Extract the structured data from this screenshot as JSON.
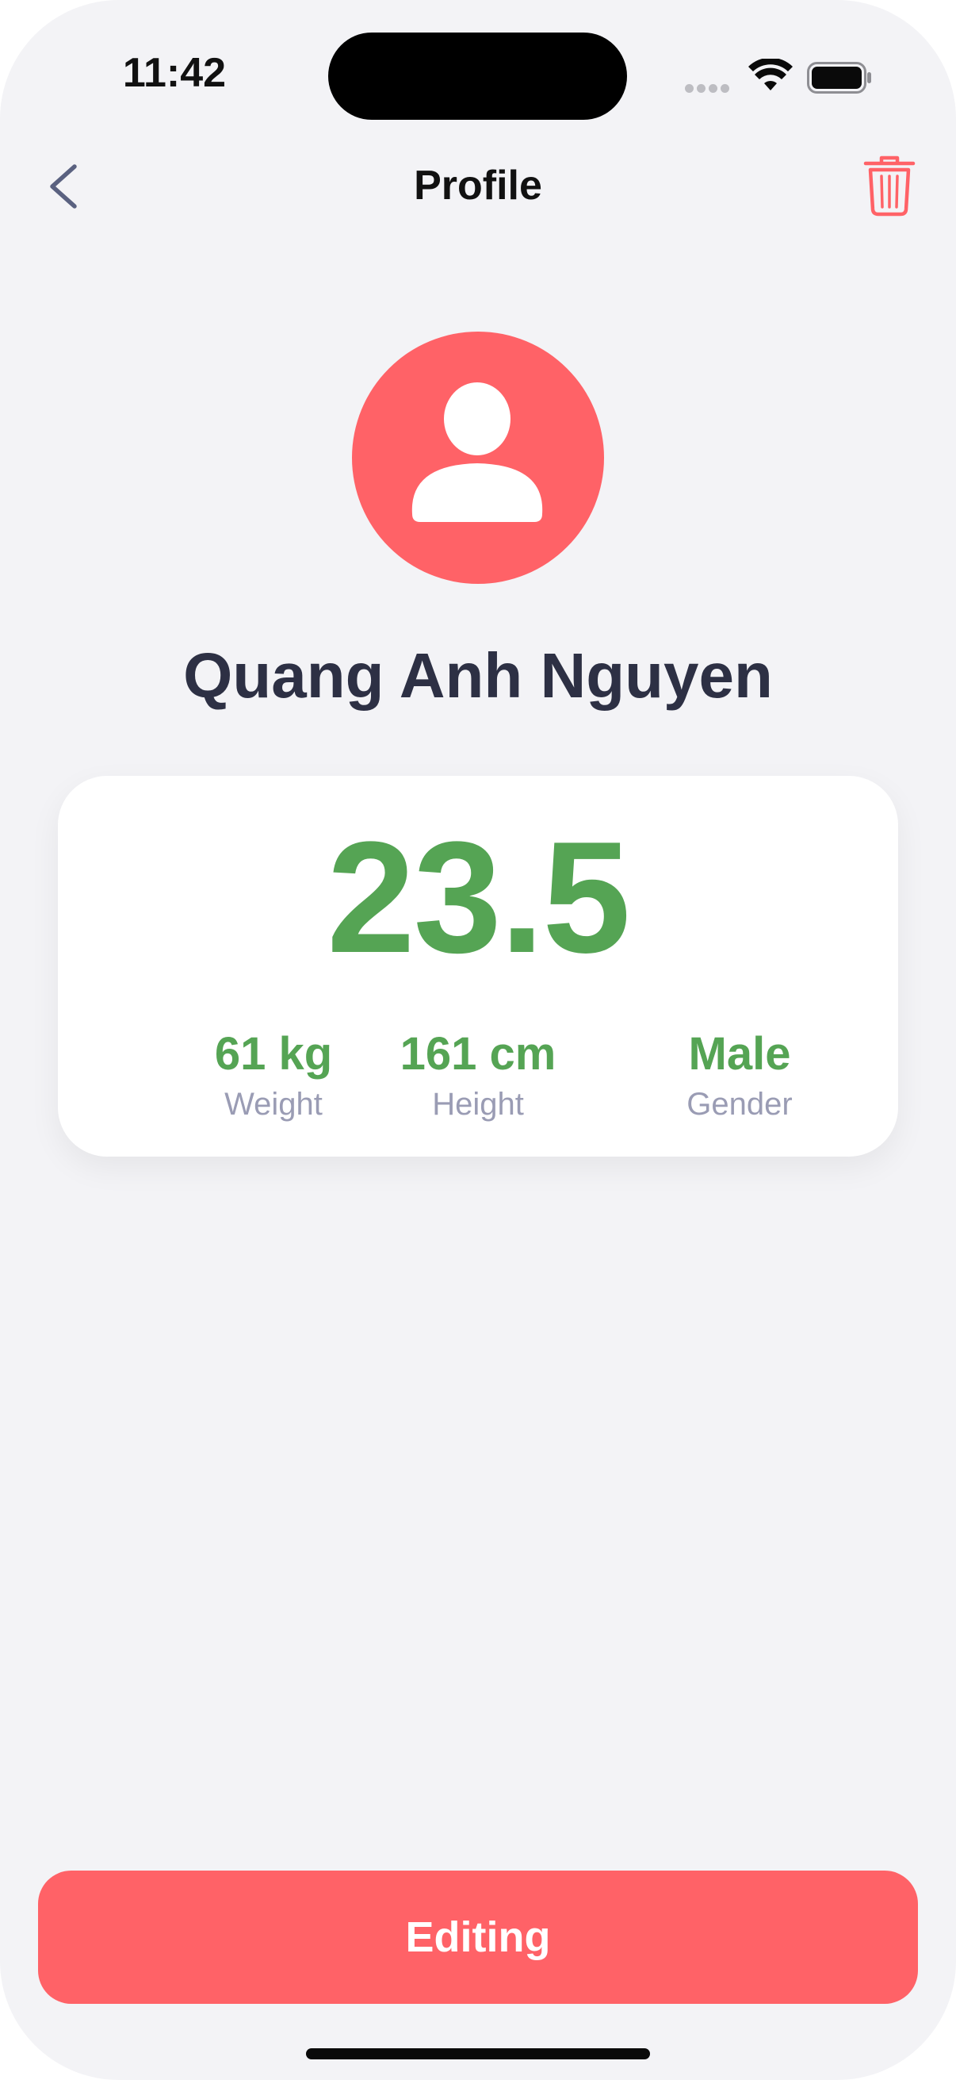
{
  "status_bar": {
    "time": "11:42"
  },
  "nav": {
    "title": "Profile",
    "back_icon": "chevron-left-icon",
    "delete_icon": "trash-icon"
  },
  "profile": {
    "avatar_icon": "person-icon",
    "name": "Quang Anh Nguyen"
  },
  "bmi_card": {
    "bmi_value": "23.5",
    "stats": [
      {
        "value": "61 kg",
        "label": "Weight"
      },
      {
        "value": "161 cm",
        "label": "Height"
      },
      {
        "value": "Male",
        "label": "Gender"
      }
    ]
  },
  "actions": {
    "edit_label": "Editing"
  },
  "colors": {
    "accent": "#ff6267",
    "bmi_green": "#55a454",
    "background": "#f3f3f6",
    "name_text": "#2d3044",
    "label_text": "#9a9cb4"
  }
}
